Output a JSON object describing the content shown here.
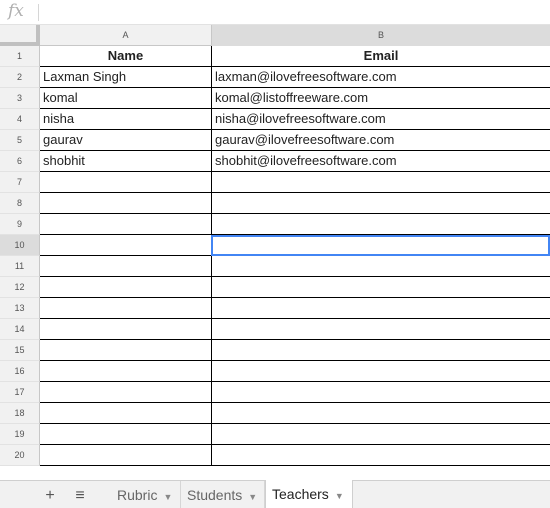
{
  "formula_bar": {
    "fx_label": "fx",
    "value": ""
  },
  "columns": [
    "A",
    "B"
  ],
  "header": {
    "name": "Name",
    "email": "Email"
  },
  "rows": [
    {
      "num": "1",
      "a": "Name",
      "b": "Email",
      "header": true
    },
    {
      "num": "2",
      "a": "Laxman Singh",
      "b": "laxman@ilovefreesoftware.com"
    },
    {
      "num": "3",
      "a": "komal",
      "b": "komal@listoffreeware.com"
    },
    {
      "num": "4",
      "a": "nisha",
      "b": "nisha@ilovefreesoftware.com"
    },
    {
      "num": "5",
      "a": "gaurav",
      "b": "gaurav@ilovefreesoftware.com"
    },
    {
      "num": "6",
      "a": "shobhit",
      "b": "shobhit@ilovefreesoftware.com"
    },
    {
      "num": "7",
      "a": "",
      "b": ""
    },
    {
      "num": "8",
      "a": "",
      "b": ""
    },
    {
      "num": "9",
      "a": "",
      "b": ""
    },
    {
      "num": "10",
      "a": "",
      "b": "",
      "selected": true
    },
    {
      "num": "11",
      "a": "",
      "b": ""
    },
    {
      "num": "12",
      "a": "",
      "b": ""
    },
    {
      "num": "13",
      "a": "",
      "b": ""
    },
    {
      "num": "14",
      "a": "",
      "b": ""
    },
    {
      "num": "15",
      "a": "",
      "b": ""
    },
    {
      "num": "16",
      "a": "",
      "b": ""
    },
    {
      "num": "17",
      "a": "",
      "b": ""
    },
    {
      "num": "18",
      "a": "",
      "b": ""
    },
    {
      "num": "19",
      "a": "",
      "b": ""
    },
    {
      "num": "20",
      "a": "",
      "b": ""
    }
  ],
  "tabs": {
    "add_icon": "+",
    "menu_icon": "≡",
    "sheets": [
      {
        "label": "Rubric",
        "active": false
      },
      {
        "label": "Students",
        "active": false
      },
      {
        "label": "Teachers",
        "active": true
      }
    ],
    "dropdown_icon": "▼"
  },
  "colors": {
    "selection": "#4285f4",
    "header_bg": "#f1f1f1",
    "selected_header_bg": "#dcdcdc"
  }
}
